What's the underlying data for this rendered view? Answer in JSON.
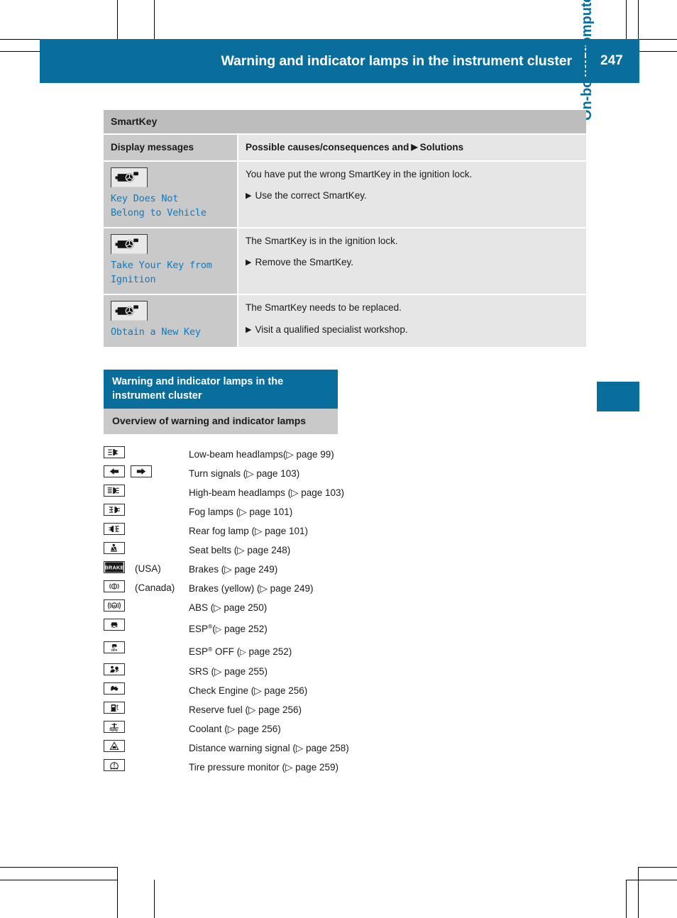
{
  "header": {
    "title": "Warning and indicator lamps in the instrument cluster",
    "page_number": "247",
    "bg_color": "#0a6e9c"
  },
  "side_tab": {
    "label": "On-board computer and displays",
    "color": "#0a6e9c"
  },
  "smartkey_table": {
    "title": "SmartKey",
    "columns": {
      "left": "Display messages",
      "right_before": "Possible causes/consequences and",
      "right_marker": "▶",
      "right_after": "Solutions"
    },
    "rows": [
      {
        "icon": "smartkey-fob-icon",
        "message": "Key Does Not\nBelong to Vehicle",
        "cause": "You have put the wrong SmartKey in the ignition lock.",
        "solution_marker": "▶",
        "solution": "Use the correct SmartKey."
      },
      {
        "icon": "smartkey-fob-icon",
        "message": "Take Your Key from\nIgnition",
        "cause": "The SmartKey is in the ignition lock.",
        "solution_marker": "▶",
        "solution": "Remove the SmartKey."
      },
      {
        "icon": "smartkey-fob-icon",
        "message": "Obtain a New Key",
        "cause": "The SmartKey needs to be replaced.",
        "solution_marker": "▶",
        "solution": "Visit a qualified specialist workshop."
      }
    ]
  },
  "section_blue": {
    "title": "Warning and indicator lamps in the instrument cluster"
  },
  "section_gray": {
    "title": "Overview of warning and indicator lamps"
  },
  "lamp_list": {
    "ref_mark": "▷",
    "items": [
      {
        "icons": [
          "low-beam-headlamp-icon"
        ],
        "region": "",
        "label": "Low-beam headlamps(▷ page 99)"
      },
      {
        "icons": [
          "turn-signal-left-icon",
          "turn-signal-right-icon"
        ],
        "region": "",
        "label": "Turn signals (▷ page 103)"
      },
      {
        "icons": [
          "high-beam-headlamp-icon"
        ],
        "region": "",
        "label": "High-beam headlamps (▷ page 103)"
      },
      {
        "icons": [
          "fog-lamp-icon"
        ],
        "region": "",
        "label": "Fog lamps (▷ page 101)"
      },
      {
        "icons": [
          "rear-fog-lamp-icon"
        ],
        "region": "",
        "label": "Rear fog lamp (▷ page 101)"
      },
      {
        "icons": [
          "seat-belt-icon"
        ],
        "region": "",
        "label": "Seat belts (▷ page 248)"
      },
      {
        "icons": [
          "brake-usa-icon"
        ],
        "region": "(USA)",
        "label": "Brakes (▷ page 249)"
      },
      {
        "icons": [
          "brake-canada-icon"
        ],
        "region": "(Canada)",
        "label": "Brakes (yellow) (▷ page 249)"
      },
      {
        "icons": [
          "abs-icon"
        ],
        "region": "",
        "label": "ABS (▷ page 250)"
      },
      {
        "icons": [
          "esp-icon"
        ],
        "region": "",
        "label": "ESP®(▷ page 252)"
      },
      {
        "icons": [
          "esp-off-icon"
        ],
        "region": "",
        "label": "ESP® OFF (▷ page 252)"
      },
      {
        "icons": [
          "srs-airbag-icon"
        ],
        "region": "",
        "label": "SRS (▷ page 255)"
      },
      {
        "icons": [
          "check-engine-icon"
        ],
        "region": "",
        "label": "Check Engine (▷ page 256)"
      },
      {
        "icons": [
          "reserve-fuel-icon"
        ],
        "region": "",
        "label": "Reserve fuel (▷ page 256)"
      },
      {
        "icons": [
          "coolant-icon"
        ],
        "region": "",
        "label": "Coolant (▷ page 256)"
      },
      {
        "icons": [
          "distance-warning-icon"
        ],
        "region": "",
        "label": "Distance warning signal (▷ page 258)"
      },
      {
        "icons": [
          "tire-pressure-monitor-icon"
        ],
        "region": "",
        "label": "Tire pressure monitor (▷ page 259)"
      }
    ]
  }
}
